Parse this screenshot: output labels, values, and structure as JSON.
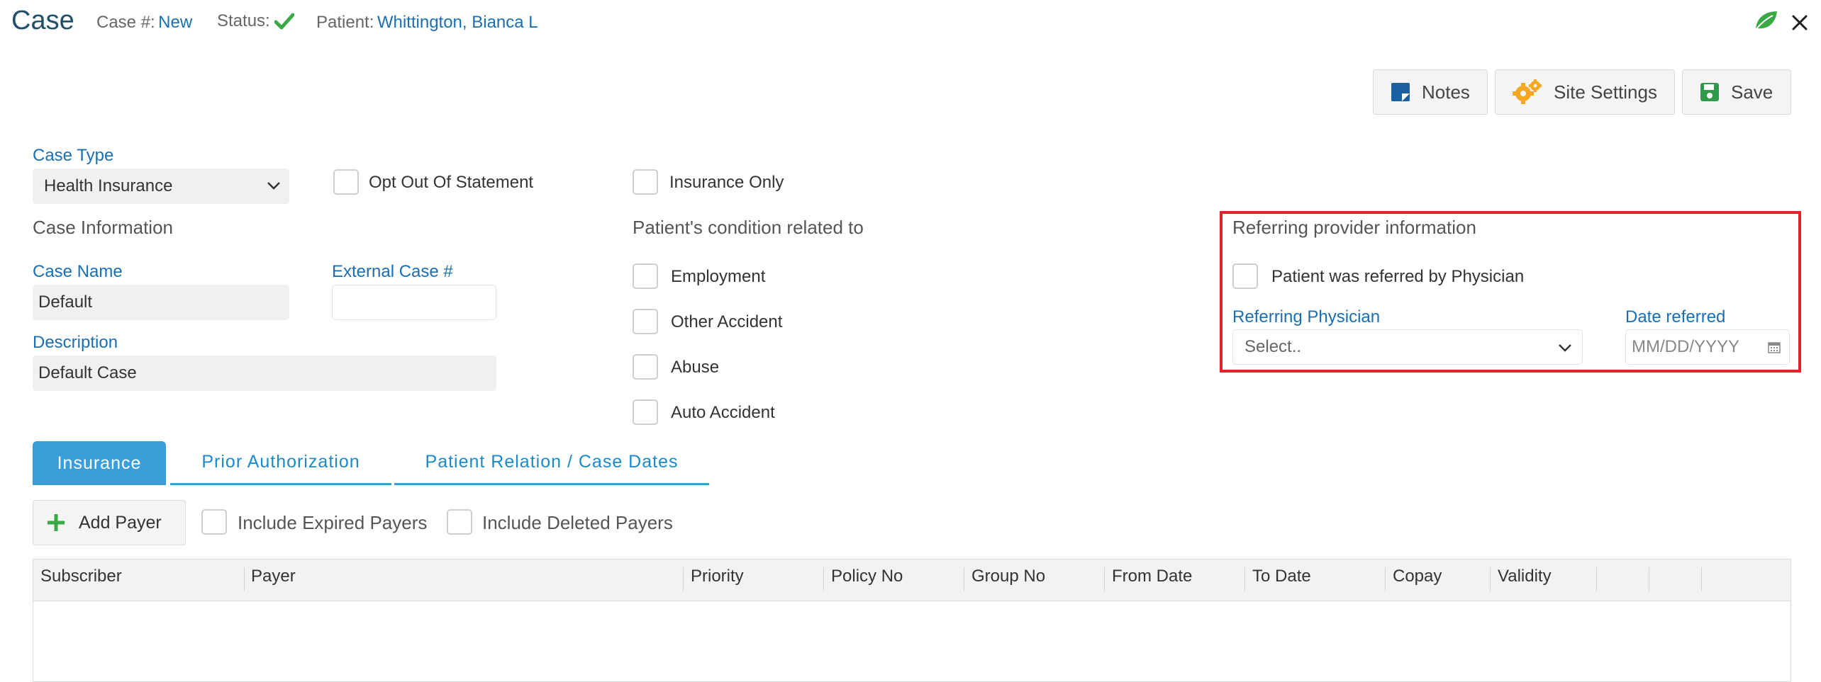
{
  "header": {
    "title": "Case",
    "case_no_label": "Case #:",
    "case_no_value": "New",
    "status_label": "Status:",
    "patient_label": "Patient:",
    "patient_value": "Whittington, Bianca L"
  },
  "toolbar": {
    "notes_label": "Notes",
    "site_settings_label": "Site Settings",
    "save_label": "Save"
  },
  "form": {
    "case_type_label": "Case Type",
    "case_type_value": "Health Insurance",
    "opt_out_label": "Opt Out Of Statement",
    "insurance_only_label": "Insurance Only",
    "case_information_heading": "Case Information",
    "case_name_label": "Case Name",
    "case_name_value": "Default",
    "external_case_label": "External Case #",
    "external_case_value": "",
    "description_label": "Description",
    "description_value": "Default Case",
    "condition_heading": "Patient's condition related to",
    "conditions": [
      "Employment",
      "Other Accident",
      "Abuse",
      "Auto Accident"
    ]
  },
  "referring": {
    "heading": "Referring provider information",
    "referred_checkbox_label": "Patient was referred by Physician",
    "physician_label": "Referring Physician",
    "physician_placeholder": "Select..",
    "date_label": "Date referred",
    "date_placeholder": "MM/DD/YYYY"
  },
  "tabs": [
    "Insurance",
    "Prior Authorization",
    "Patient Relation / Case Dates"
  ],
  "payers": {
    "add_payer_label": "Add Payer",
    "include_expired_label": "Include Expired Payers",
    "include_deleted_label": "Include Deleted Payers"
  },
  "table": {
    "columns": [
      "Subscriber",
      "Payer",
      "Priority",
      "Policy No",
      "Group No",
      "From Date",
      "To Date",
      "Copay",
      "Validity"
    ],
    "rows": []
  },
  "colors": {
    "accent": "#1a6fb3",
    "tab_active": "#3b9ed8",
    "highlight_border": "#e0242c",
    "status_check": "#3aa845",
    "settings_icon": "#f5a623",
    "save_icon": "#2e9a4a",
    "notes_icon": "#1a5fa0"
  }
}
